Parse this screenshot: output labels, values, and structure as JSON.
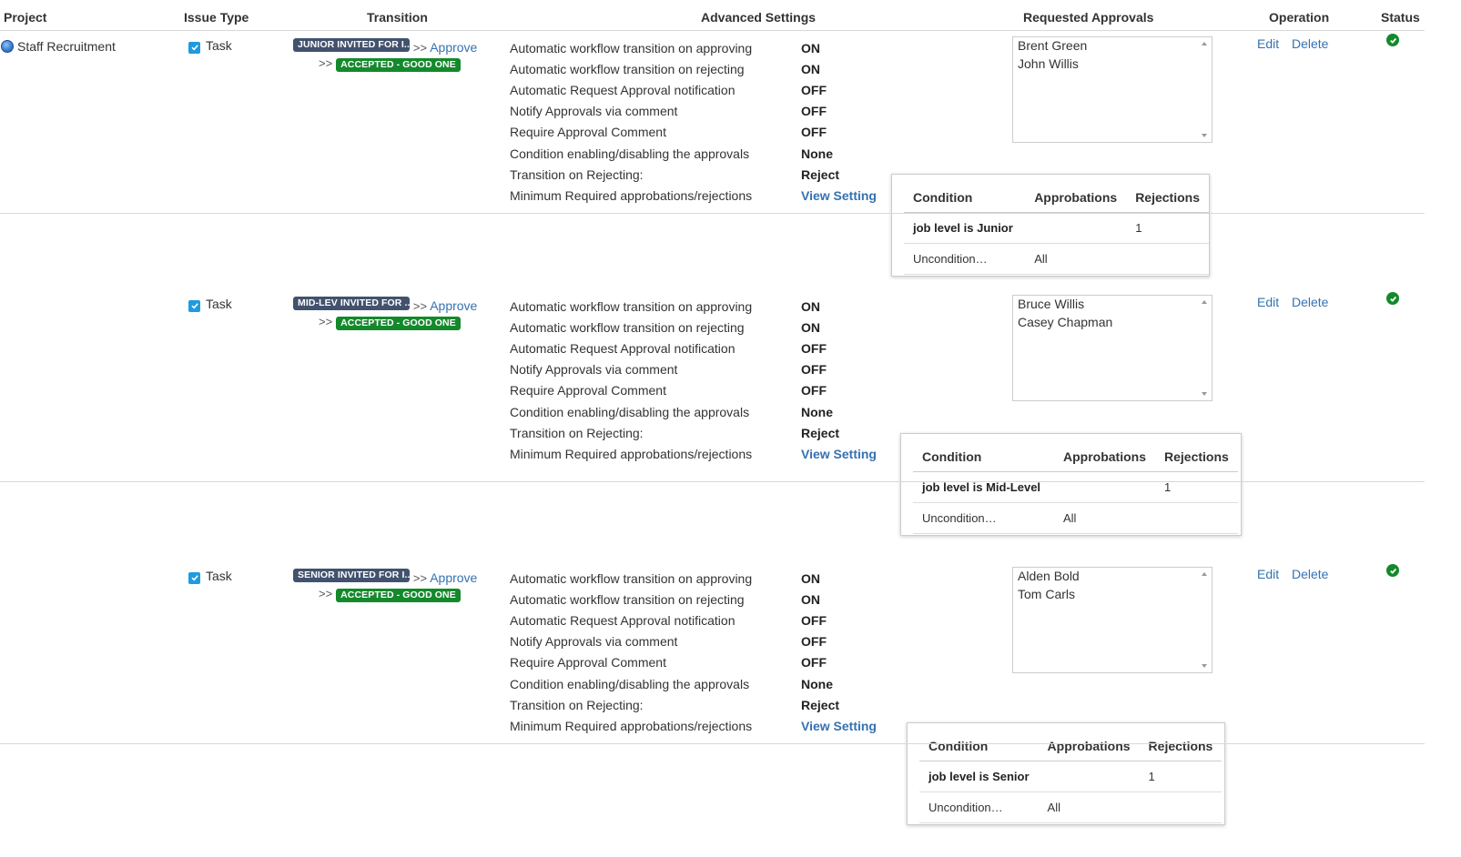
{
  "headers": {
    "project": "Project",
    "issue_type": "Issue Type",
    "transition": "Transition",
    "advanced_settings": "Advanced Settings",
    "requested_approvals": "Requested Approvals",
    "operation": "Operation",
    "status": "Status"
  },
  "project_name": "Staff Recruitment",
  "common": {
    "issue_type": "Task",
    "approve": "Approve",
    "arrow": ">>",
    "target_status": "ACCEPTED - GOOD ONE",
    "edit": "Edit",
    "delete": "Delete",
    "settings_labels": [
      "Automatic workflow transition on approving",
      "Automatic workflow transition on rejecting",
      "Automatic Request Approval notification",
      "Notify Approvals via comment",
      "Require Approval Comment",
      "Condition enabling/disabling the approvals",
      "Transition on Rejecting:",
      "Minimum Required approbations/rejections"
    ],
    "settings_values": [
      "ON",
      "ON",
      "OFF",
      "OFF",
      "OFF",
      "None",
      "Reject",
      "View Setting"
    ],
    "popup_headers": [
      "Condition",
      "Approbations",
      "Rejections"
    ],
    "uncondition": "Uncondition…",
    "all": "All"
  },
  "rows": [
    {
      "source_status": "JUNIOR INVITED FOR I...",
      "approvers": [
        "Brent Green",
        "John Willis"
      ],
      "condition": "job level is Junior",
      "rejections": "1"
    },
    {
      "source_status": "MID-LEV INVITED FOR ...",
      "approvers": [
        "Bruce Willis",
        "Casey Chapman"
      ],
      "condition": "job level is Mid-Level",
      "rejections": "1"
    },
    {
      "source_status": "SENIOR INVITED FOR I...",
      "approvers": [
        "Alden Bold",
        "Tom Carls"
      ],
      "condition": "job level is Senior",
      "rejections": "1"
    }
  ]
}
